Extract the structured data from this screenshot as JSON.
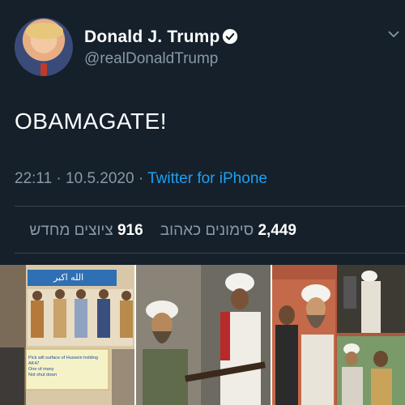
{
  "tweet": {
    "display_name": "Donald J. Trump",
    "handle": "@realDonaldTrump",
    "text": "OBAMAGATE!",
    "time": "22:11",
    "date": "10.5.2020",
    "source": "Twitter for iPhone",
    "likes_count": "2,449",
    "likes_label": "סימונים כאהוב",
    "retweets_count": "916",
    "retweets_label": "ציוצים מחדש"
  },
  "icons": {
    "verified": "verified-badge-icon",
    "menu": "chevron-down-icon"
  },
  "colors": {
    "background": "#15202b",
    "muted_text": "#8899a6",
    "link": "#1da1f2",
    "divider": "#38444d"
  },
  "collage": {
    "panel_1_banner_text": "الله اكبر",
    "panel_1_caption_lines": [
      "Pick will surface of Hussein holding AK47",
      "One of many",
      "Not shut down"
    ]
  }
}
